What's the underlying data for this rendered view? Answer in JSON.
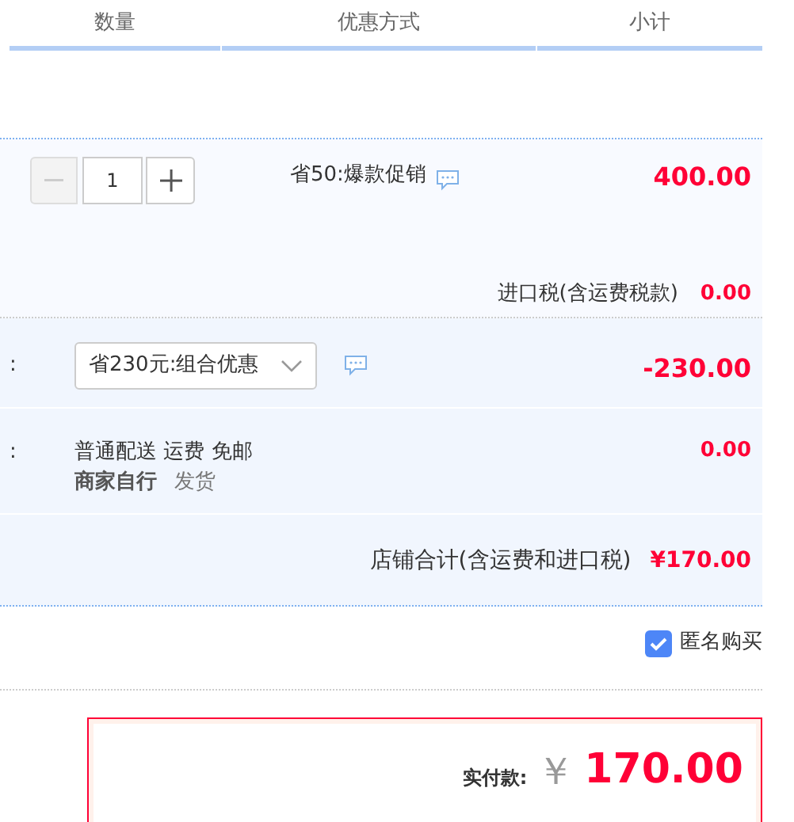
{
  "table": {
    "columns": [
      "数量",
      "优惠方式",
      "小计"
    ]
  },
  "item": {
    "quantity": "1",
    "promotion": "省50:爆款促销",
    "subtotal": "400.00",
    "tax_label": "进口税(含运费税款)",
    "tax": "0.00"
  },
  "discount": {
    "label": ":",
    "selected_option": "省230元:组合优惠",
    "amount": "-230.00"
  },
  "delivery": {
    "label": ":",
    "line_1": "普通配送 运费 免邮",
    "line_2_label": "商家自行",
    "line_2_value": "发货",
    "amount": "0.00"
  },
  "store_total": {
    "label": "店铺合计(含运费和进口税)",
    "amount": "¥170.00"
  },
  "anonymous": {
    "label": "匿名购买",
    "checked": true
  },
  "payment": {
    "label": "实付款:",
    "currency": "￥",
    "amount": "170.00"
  }
}
